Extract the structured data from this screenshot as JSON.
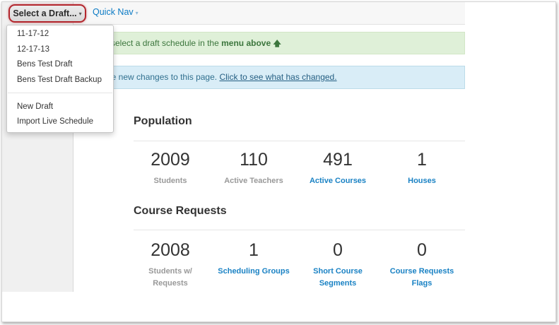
{
  "toolbar": {
    "select_draft_label": "Select a Draft...",
    "quick_nav_label": "Quick Nav"
  },
  "dropdown": {
    "items": [
      "11-17-12",
      "12-17-13",
      "Bens Test Draft",
      "Bens Test Draft Backup"
    ],
    "actions": [
      "New Draft",
      "Import Live Schedule"
    ]
  },
  "alerts": {
    "green_prefix": "e select a draft schedule in the",
    "green_bold": "menu above",
    "blue_prefix": "are new changes to this page.",
    "blue_link": "Click to see what has changed."
  },
  "population": {
    "title": "Population",
    "stats": [
      {
        "value": "2009",
        "label": "Students"
      },
      {
        "value": "110",
        "label": "Active Teachers"
      },
      {
        "value": "491",
        "label": "Active Courses"
      },
      {
        "value": "1",
        "label": "Houses"
      }
    ]
  },
  "course_requests": {
    "title": "Course Requests",
    "stats": [
      {
        "value": "2008",
        "label": "Students w/ Requests"
      },
      {
        "value": "1",
        "label": "Scheduling Groups"
      },
      {
        "value": "0",
        "label": "Short Course Segments"
      },
      {
        "value": "0",
        "label": "Course Requests Flags"
      }
    ]
  },
  "colors": {
    "accent_link": "#1a82c4",
    "highlight_ring": "#b3262d",
    "success_bg": "#dff0d8",
    "info_bg": "#d9edf7"
  }
}
